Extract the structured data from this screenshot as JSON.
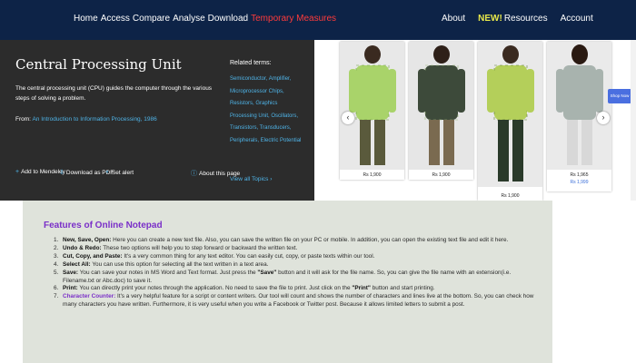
{
  "topnav": {
    "left_items": [
      "Home",
      "Access",
      "Compare",
      "Analyse",
      "Download"
    ],
    "danger_item": "Temporary Measures",
    "about": "About",
    "new_badge": "NEW!",
    "resources": "Resources",
    "account": "Account"
  },
  "article": {
    "title": "Central Processing Unit",
    "description": "The central processing unit (CPU) guides the computer through the various steps of solving a problem.",
    "from_label": "From:",
    "from_link": "An Introduction to Information Processing, 1986",
    "related_heading": "Related terms:",
    "related_links": "Semiconductor, Amplifier, Microprocessor Chips, Resistors, Graphics Processing Unit, Oscillators, Transistors, Transducers, Peripherals, Electric Potential",
    "view_topics": "View all Topics",
    "actions": {
      "add_mendeley": "Add to Mendeley",
      "download_pdf": "Download as PDF",
      "set_alert": "Set alert",
      "about_page": "About this page"
    }
  },
  "carousel": {
    "products": [
      {
        "price": "Rs 1,900",
        "icon": "shirt-photo-green-checked"
      },
      {
        "price": "Rs 1,900",
        "icon": "shirt-photo-dark-checked"
      },
      {
        "price": "Rs 1,900",
        "icon": "shirt-photo-lime-checked"
      },
      {
        "price": "Rs 1,965",
        "price_note": "Rs 1,999",
        "icon": "shirt-photo-grey-plain"
      }
    ],
    "prev_icon": "chevron-left-icon",
    "next_icon": "chevron-right-icon",
    "prev_glyph": "‹",
    "next_glyph": "›",
    "buy_label": "Shop Now"
  },
  "features": {
    "heading": "Features of Online Notepad",
    "items": [
      {
        "num": "1.",
        "title": "New, Save, Open:",
        "text": "Here you can create a new text file. Also, you can save the written file on your PC or mobile. In addition, you can open the existing text file and edit it here."
      },
      {
        "num": "2.",
        "title": "Undo & Redo:",
        "text": "These two options will help you to step forward or backward the written text."
      },
      {
        "num": "3.",
        "title": "Cut, Copy, and Paste:",
        "text": "It's a very common thing for any text editor. You can easily cut, copy, or paste texts within our tool."
      },
      {
        "num": "4.",
        "title": "Select All:",
        "text": "You can use this option for selecting all the text written in a text area."
      },
      {
        "num": "5.",
        "title": "Save:",
        "text_a": "You can save your notes in MS Word and Text format. Just press the ",
        "quote": "\"Save\"",
        "text_b": " button and it will ask for the file name. So, you can give the file name with an extension(i.e. Filename.txt or Abc.doc) to save it."
      },
      {
        "num": "6.",
        "title": "Print:",
        "text_a": "You can directly print your notes through the application. No need to save the file to print. Just click on the ",
        "quote": "\"Print\"",
        "text_b": " button and start printing."
      },
      {
        "num": "7.",
        "title": "Character Counter:",
        "text": "It's a very helpful feature for a script or content writers. Our tool will count and shows the number of characters and lines live at the bottom. So, you can check how many characters you have written. Furthermore, it is very useful when you write a Facebook or Twitter post. Because it allows limited letters to submit a post."
      }
    ]
  }
}
